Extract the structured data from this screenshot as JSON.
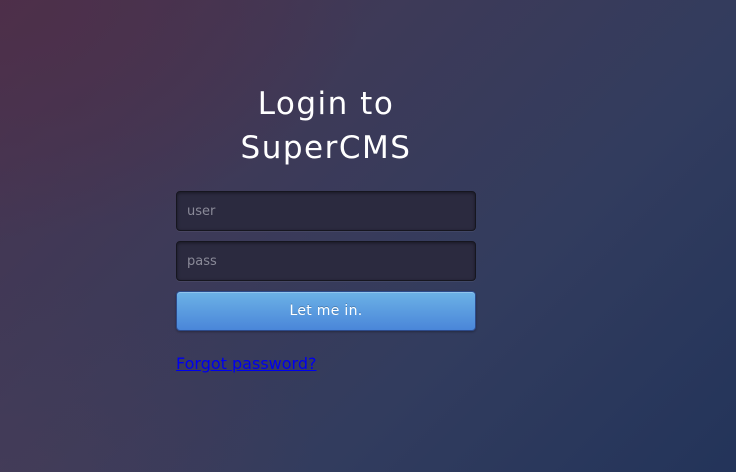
{
  "login": {
    "title_line1": "Login to",
    "title_line2": "SuperCMS",
    "user_placeholder": "user",
    "pass_placeholder": "pass",
    "submit_label": "Let me in.",
    "forgot_label": "Forgot password?"
  },
  "colors": {
    "button_top": "#6cb2e6",
    "button_bottom": "#4a86d9",
    "link": "#0000ee",
    "field_bg": "#2b2a3f"
  }
}
